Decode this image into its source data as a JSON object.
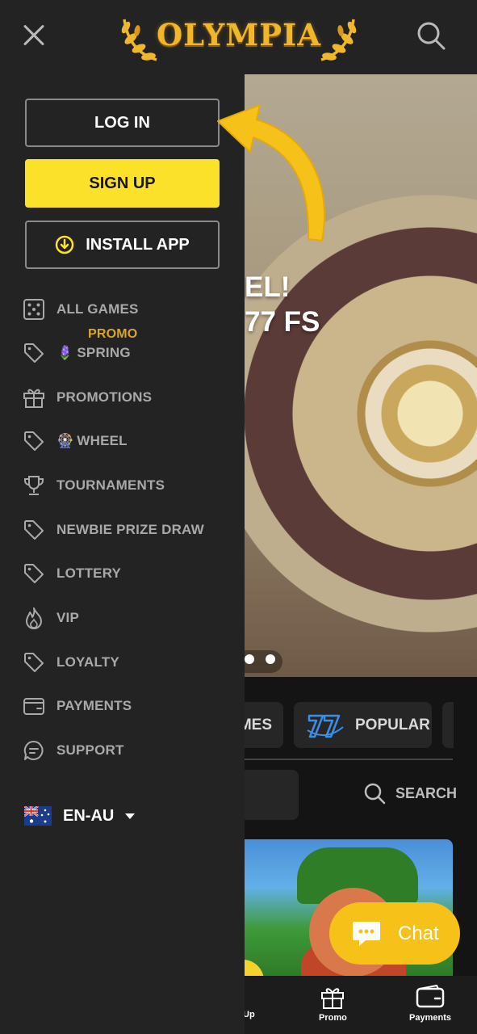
{
  "header": {
    "logo_text": "OLYMPIA"
  },
  "drawer": {
    "login_label": "LOG IN",
    "signup_label": "SIGN UP",
    "install_label": "INSTALL APP",
    "menu": [
      {
        "label": "ALL GAMES",
        "icon": "dice-icon"
      },
      {
        "label": "SPRING",
        "promo": "PROMO",
        "emoji": "🪻",
        "icon": "tag-icon"
      },
      {
        "label": "PROMOTIONS",
        "icon": "gift-icon"
      },
      {
        "label": "WHEEL",
        "emoji": "🎡",
        "icon": "tag-icon"
      },
      {
        "label": "TOURNAMENTS",
        "icon": "trophy-icon"
      },
      {
        "label": "NEWBIE PRIZE DRAW",
        "icon": "tag-icon"
      },
      {
        "label": "LOTTERY",
        "icon": "tag-icon"
      },
      {
        "label": "VIP",
        "icon": "flame-icon"
      },
      {
        "label": "LOYALTY",
        "icon": "tag-icon"
      },
      {
        "label": "PAYMENTS",
        "icon": "wallet-icon"
      },
      {
        "label": "SUPPORT",
        "icon": "chat-bubble-icon"
      }
    ],
    "language": "EN-AU"
  },
  "hero": {
    "line1": "EL!",
    "line2": "77 FS"
  },
  "categories": {
    "tab_partial": "MES",
    "tab_popular": "POPULAR"
  },
  "search_label": "SEARCH",
  "chat_label": "Chat",
  "bottom_nav": {
    "item1": "Up",
    "item2": "Promo",
    "item3": "Payments"
  },
  "colors": {
    "accent_yellow": "#fbe12a",
    "drawer_bg": "#232323",
    "logo_gold": "#f1b72c",
    "promo_gold": "#d7a72a"
  }
}
